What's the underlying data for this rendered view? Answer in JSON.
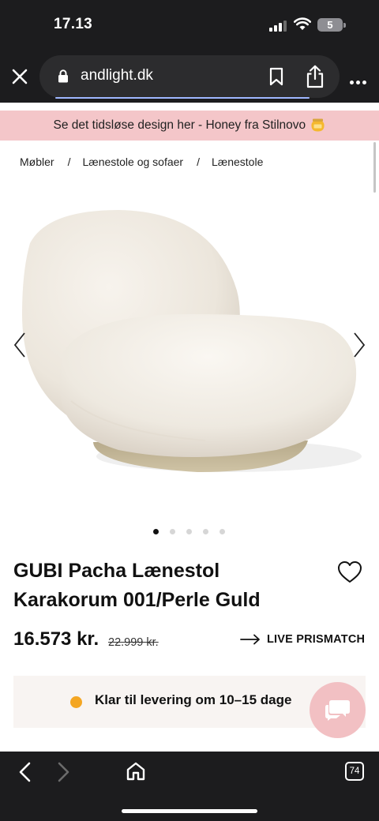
{
  "status_bar": {
    "time": "17.13",
    "battery_level": "5"
  },
  "browser": {
    "url": "andlight.dk",
    "tab_count": "74",
    "icons": [
      "close-icon",
      "lock-icon",
      "bookmark-icon",
      "share-icon",
      "more-icon",
      "back-icon",
      "forward-icon",
      "home-icon",
      "tabs-icon"
    ]
  },
  "promo": {
    "text": "Se det tidsløse design her - Honey fra Stilnovo",
    "icon": "honey-jar-icon"
  },
  "breadcrumb": {
    "items": [
      "Møbler",
      "Lænestole og sofaer",
      "Lænestole"
    ],
    "separator": "/"
  },
  "gallery": {
    "image_count": 5,
    "active_index": 0
  },
  "product": {
    "title_line1": "GUBI Pacha Lænestol",
    "title_line2": "Karakorum 001/Perle Guld",
    "price": "16.573 kr.",
    "old_price": "22.999 kr.",
    "prismatch_label": "LIVE PRISMATCH"
  },
  "delivery": {
    "text": "Klar til levering om 10–15 dage",
    "status_color": "#f4a623"
  },
  "colors": {
    "promo_bg": "#f4c6c9",
    "chat_bg": "#f2c0c3",
    "browser_chrome": "#1c1c1e"
  }
}
